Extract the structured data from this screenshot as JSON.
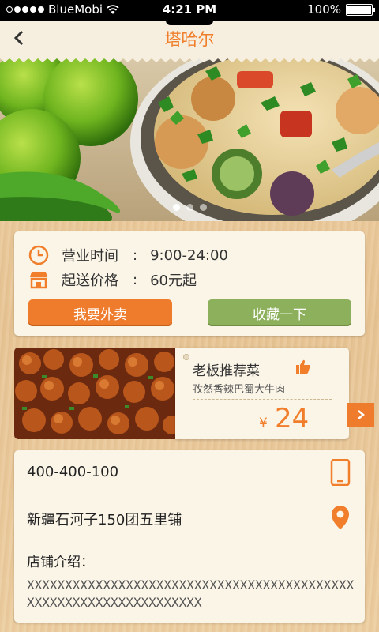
{
  "status_bar": {
    "carrier": "BlueMobi",
    "time": "4:21 PM",
    "battery": "100%"
  },
  "nav": {
    "title": "塔哈尔"
  },
  "hero": {
    "slide_count": 3,
    "active_slide": 1
  },
  "info": {
    "hours_label": "营业时间",
    "hours_sep": ":",
    "hours_value": "9:00-24:00",
    "min_label": "起送价格",
    "min_sep": ":",
    "min_value": "60元起",
    "order_button": "我要外卖",
    "fav_button": "收藏一下"
  },
  "recommend": {
    "title": "老板推荐菜",
    "dish": "孜然香辣巴蜀大牛肉",
    "currency": "¥",
    "price": "24"
  },
  "details": {
    "phone": "400-400-100",
    "address": "新疆石河子150团五里铺",
    "intro_label": "店铺介绍：",
    "intro_text": "XXXXXXXXXXXXXXXXXXXXXXXXXXXXXXXXXXXXXXXXXXXXXXXXXXXXXXXXXXXXXXXXXX"
  },
  "colors": {
    "accent": "#f07e2b",
    "green": "#8cb05c",
    "card": "#fbf5e8"
  }
}
